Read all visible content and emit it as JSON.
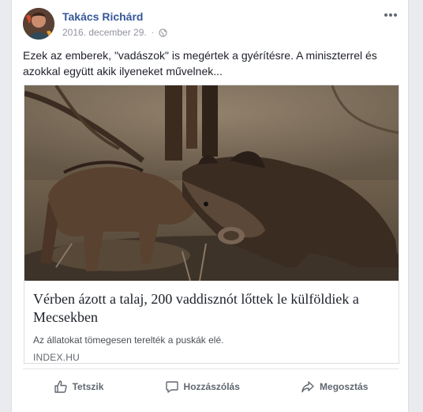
{
  "post": {
    "author": "Takács Richárd",
    "date": "2016. december 29.",
    "separator": "·",
    "text": "Ezek az emberek, \"vadászok\" is megértek a gyérítésre. A miniszterrel és azokkal együtt akik ilyeneket művelnek..."
  },
  "link": {
    "title": "Vérben ázott a talaj, 200 vaddisznót lőttek le külföldiek a Mecsekben",
    "description": "Az állatokat tömegesen terelték a puskák elé.",
    "domain": "INDEX.HU"
  },
  "actions": {
    "like": "Tetszik",
    "comment": "Hozzászólás",
    "share": "Megosztás"
  },
  "colors": {
    "author": "#365899",
    "muted": "#90949c",
    "action": "#606770"
  }
}
